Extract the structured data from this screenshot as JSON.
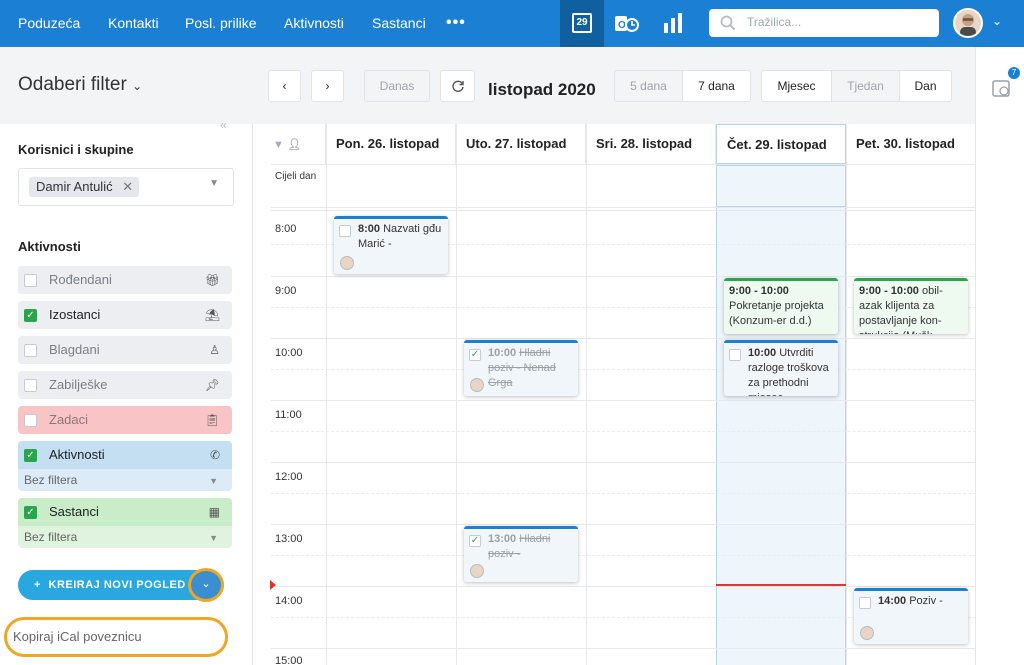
{
  "nav": {
    "items": [
      "Poduzeća",
      "Kontakti",
      "Posl. prilike",
      "Aktivnosti",
      "Sastanci"
    ],
    "calendar_day": "29",
    "search_placeholder": "Tražilica...",
    "notif_count": "7"
  },
  "toolbar": {
    "filter_title": "Odaberi filter",
    "today": "Danas",
    "period": "listopad 2020",
    "range": [
      "5 dana",
      "7 dana"
    ],
    "views": [
      "Mjesec",
      "Tjedan",
      "Dan"
    ]
  },
  "sidebar": {
    "users_title": "Korisnici i skupine",
    "user_chip": "Damir Antulić",
    "activities_title": "Aktivnosti",
    "items": [
      {
        "label": "Rođendani",
        "checked": false,
        "bg": "#eceef1",
        "text": "#7a7f86"
      },
      {
        "label": "Izostanci",
        "checked": true,
        "bg": "#eceef1",
        "text": "#222"
      },
      {
        "label": "Blagdani",
        "checked": false,
        "bg": "#eceef1",
        "text": "#7a7f86"
      },
      {
        "label": "Zabilješke",
        "checked": false,
        "bg": "#eceef1",
        "text": "#7a7f86"
      },
      {
        "label": "Zadaci",
        "checked": false,
        "bg": "#f9c4c6",
        "text": "#8b7777"
      },
      {
        "label": "Aktivnosti",
        "checked": true,
        "bg": "#c4def2",
        "text": "#222"
      },
      {
        "label": "Sastanci",
        "checked": true,
        "bg": "#c9ecc9",
        "text": "#222"
      }
    ],
    "sub_filter": "Bez filtera",
    "create_button": "KREIRAJ NOVI POGLED",
    "ical_link": "Kopiraj iCal poveznicu"
  },
  "calendar": {
    "days": [
      "Pon. 26. listopad",
      "Uto. 27. listopad",
      "Sri. 28. listopad",
      "Čet. 29. listopad",
      "Pet. 30. listopad"
    ],
    "all_day_label": "Cijeli dan",
    "hours": [
      "8:00",
      "9:00",
      "10:00",
      "11:00",
      "12:00",
      "13:00",
      "14:00",
      "15:00"
    ],
    "events": [
      {
        "time": "8:00",
        "title": "Nazvati gđu Marić -",
        "done": false
      },
      {
        "time": "10:00",
        "title": "Hladni poziv - Nenad Grga",
        "done": true
      },
      {
        "time": "13:00",
        "title": "Hladni poziv -",
        "done": true
      },
      {
        "time": "9:00 - 10:00",
        "title": "Pokretanje projekta (Konzum-er d.d.)"
      },
      {
        "time": "10:00",
        "title": "Utvrditi razloge troškova za prethodni mjesec",
        "done": false
      },
      {
        "time": "9:00 - 10:00",
        "title": "obil-azak klijenta za postavljanje kon-strukcija (Mušk"
      },
      {
        "time": "14:00",
        "title": "Poziv -",
        "done": false
      }
    ]
  }
}
